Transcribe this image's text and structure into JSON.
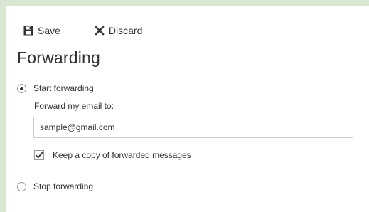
{
  "toolbar": {
    "save_label": "Save",
    "discard_label": "Discard"
  },
  "title": "Forwarding",
  "options": {
    "start_label": "Start forwarding",
    "start_selected": true,
    "stop_label": "Stop forwarding",
    "stop_selected": false
  },
  "forward": {
    "label": "Forward my email to:",
    "email_value": "sample@gmail.com",
    "keep_copy_label": "Keep a copy of forwarded messages",
    "keep_copy_checked": true
  },
  "icons": {
    "save": "save-icon",
    "discard": "close-icon",
    "checkmark": "checkmark-icon"
  },
  "colors": {
    "background": "#d9e6d2",
    "panel": "#ffffff",
    "text": "#333333"
  }
}
